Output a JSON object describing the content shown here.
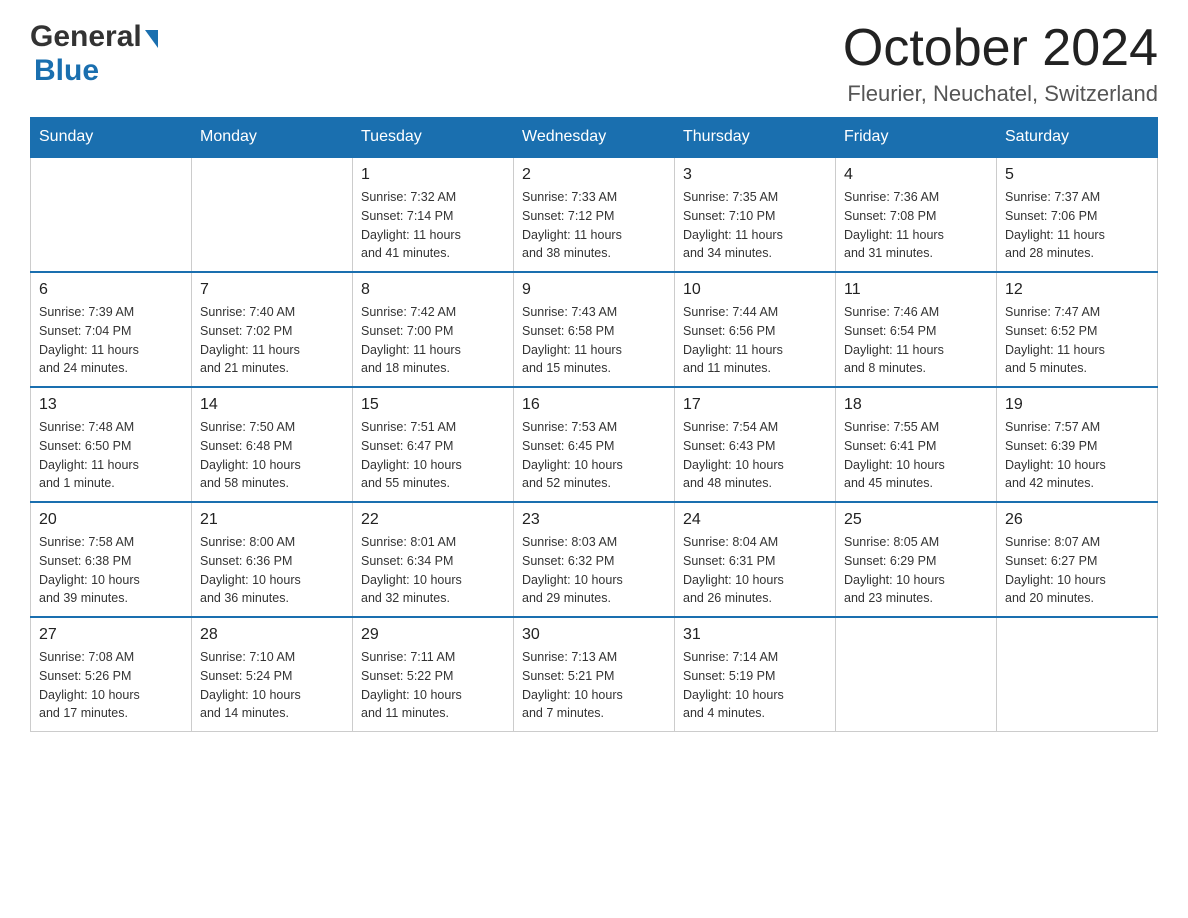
{
  "header": {
    "logo_general": "General",
    "logo_blue": "Blue",
    "month_title": "October 2024",
    "location": "Fleurier, Neuchatel, Switzerland"
  },
  "days_of_week": [
    "Sunday",
    "Monday",
    "Tuesday",
    "Wednesday",
    "Thursday",
    "Friday",
    "Saturday"
  ],
  "weeks": [
    [
      {
        "day": "",
        "info": ""
      },
      {
        "day": "",
        "info": ""
      },
      {
        "day": "1",
        "info": "Sunrise: 7:32 AM\nSunset: 7:14 PM\nDaylight: 11 hours\nand 41 minutes."
      },
      {
        "day": "2",
        "info": "Sunrise: 7:33 AM\nSunset: 7:12 PM\nDaylight: 11 hours\nand 38 minutes."
      },
      {
        "day": "3",
        "info": "Sunrise: 7:35 AM\nSunset: 7:10 PM\nDaylight: 11 hours\nand 34 minutes."
      },
      {
        "day": "4",
        "info": "Sunrise: 7:36 AM\nSunset: 7:08 PM\nDaylight: 11 hours\nand 31 minutes."
      },
      {
        "day": "5",
        "info": "Sunrise: 7:37 AM\nSunset: 7:06 PM\nDaylight: 11 hours\nand 28 minutes."
      }
    ],
    [
      {
        "day": "6",
        "info": "Sunrise: 7:39 AM\nSunset: 7:04 PM\nDaylight: 11 hours\nand 24 minutes."
      },
      {
        "day": "7",
        "info": "Sunrise: 7:40 AM\nSunset: 7:02 PM\nDaylight: 11 hours\nand 21 minutes."
      },
      {
        "day": "8",
        "info": "Sunrise: 7:42 AM\nSunset: 7:00 PM\nDaylight: 11 hours\nand 18 minutes."
      },
      {
        "day": "9",
        "info": "Sunrise: 7:43 AM\nSunset: 6:58 PM\nDaylight: 11 hours\nand 15 minutes."
      },
      {
        "day": "10",
        "info": "Sunrise: 7:44 AM\nSunset: 6:56 PM\nDaylight: 11 hours\nand 11 minutes."
      },
      {
        "day": "11",
        "info": "Sunrise: 7:46 AM\nSunset: 6:54 PM\nDaylight: 11 hours\nand 8 minutes."
      },
      {
        "day": "12",
        "info": "Sunrise: 7:47 AM\nSunset: 6:52 PM\nDaylight: 11 hours\nand 5 minutes."
      }
    ],
    [
      {
        "day": "13",
        "info": "Sunrise: 7:48 AM\nSunset: 6:50 PM\nDaylight: 11 hours\nand 1 minute."
      },
      {
        "day": "14",
        "info": "Sunrise: 7:50 AM\nSunset: 6:48 PM\nDaylight: 10 hours\nand 58 minutes."
      },
      {
        "day": "15",
        "info": "Sunrise: 7:51 AM\nSunset: 6:47 PM\nDaylight: 10 hours\nand 55 minutes."
      },
      {
        "day": "16",
        "info": "Sunrise: 7:53 AM\nSunset: 6:45 PM\nDaylight: 10 hours\nand 52 minutes."
      },
      {
        "day": "17",
        "info": "Sunrise: 7:54 AM\nSunset: 6:43 PM\nDaylight: 10 hours\nand 48 minutes."
      },
      {
        "day": "18",
        "info": "Sunrise: 7:55 AM\nSunset: 6:41 PM\nDaylight: 10 hours\nand 45 minutes."
      },
      {
        "day": "19",
        "info": "Sunrise: 7:57 AM\nSunset: 6:39 PM\nDaylight: 10 hours\nand 42 minutes."
      }
    ],
    [
      {
        "day": "20",
        "info": "Sunrise: 7:58 AM\nSunset: 6:38 PM\nDaylight: 10 hours\nand 39 minutes."
      },
      {
        "day": "21",
        "info": "Sunrise: 8:00 AM\nSunset: 6:36 PM\nDaylight: 10 hours\nand 36 minutes."
      },
      {
        "day": "22",
        "info": "Sunrise: 8:01 AM\nSunset: 6:34 PM\nDaylight: 10 hours\nand 32 minutes."
      },
      {
        "day": "23",
        "info": "Sunrise: 8:03 AM\nSunset: 6:32 PM\nDaylight: 10 hours\nand 29 minutes."
      },
      {
        "day": "24",
        "info": "Sunrise: 8:04 AM\nSunset: 6:31 PM\nDaylight: 10 hours\nand 26 minutes."
      },
      {
        "day": "25",
        "info": "Sunrise: 8:05 AM\nSunset: 6:29 PM\nDaylight: 10 hours\nand 23 minutes."
      },
      {
        "day": "26",
        "info": "Sunrise: 8:07 AM\nSunset: 6:27 PM\nDaylight: 10 hours\nand 20 minutes."
      }
    ],
    [
      {
        "day": "27",
        "info": "Sunrise: 7:08 AM\nSunset: 5:26 PM\nDaylight: 10 hours\nand 17 minutes."
      },
      {
        "day": "28",
        "info": "Sunrise: 7:10 AM\nSunset: 5:24 PM\nDaylight: 10 hours\nand 14 minutes."
      },
      {
        "day": "29",
        "info": "Sunrise: 7:11 AM\nSunset: 5:22 PM\nDaylight: 10 hours\nand 11 minutes."
      },
      {
        "day": "30",
        "info": "Sunrise: 7:13 AM\nSunset: 5:21 PM\nDaylight: 10 hours\nand 7 minutes."
      },
      {
        "day": "31",
        "info": "Sunrise: 7:14 AM\nSunset: 5:19 PM\nDaylight: 10 hours\nand 4 minutes."
      },
      {
        "day": "",
        "info": ""
      },
      {
        "day": "",
        "info": ""
      }
    ]
  ]
}
